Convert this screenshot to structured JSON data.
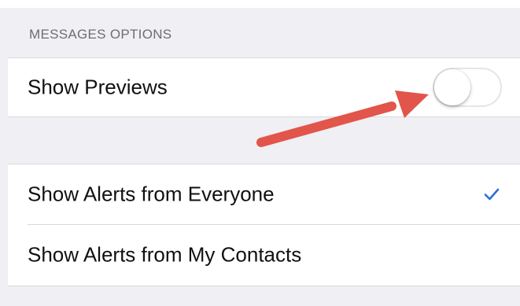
{
  "messages_options": {
    "header": "MESSAGES OPTIONS",
    "show_previews": {
      "label": "Show Previews",
      "toggle_on": false
    }
  },
  "alerts": {
    "items": [
      {
        "label": "Show Alerts from Everyone",
        "selected": true
      },
      {
        "label": "Show Alerts from My Contacts",
        "selected": false
      }
    ]
  },
  "colors": {
    "background": "#efeff4",
    "checkmark": "#2f6fd0",
    "arrow": "#e2554a"
  },
  "icons": {
    "selected_mark": "checkmark-icon",
    "annotation": "arrow-icon"
  }
}
